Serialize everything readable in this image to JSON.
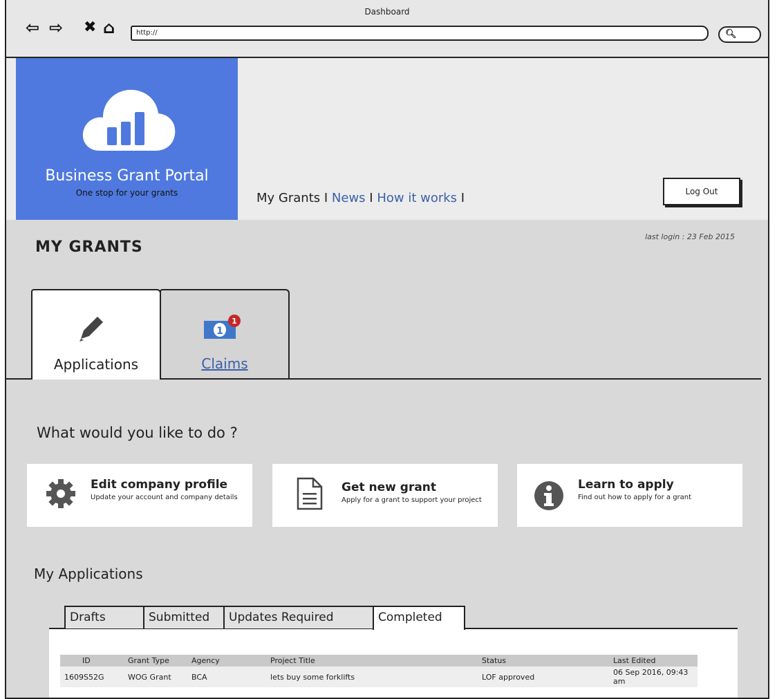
{
  "window": {
    "title": "Dashboard",
    "url": "http://"
  },
  "brand": {
    "name": "Business Grant Portal",
    "tagline": "One stop for your grants",
    "color": "#4f79de"
  },
  "topnav": {
    "items": [
      "My Grants",
      "News",
      "How it works"
    ],
    "separator": "I"
  },
  "header": {
    "logout_label": "Log Out"
  },
  "page": {
    "title": "MY GRANTS",
    "last_login": "last login : 23 Feb 2015"
  },
  "tabs": [
    {
      "label": "Applications",
      "icon": "pencil-icon",
      "active": true
    },
    {
      "label": "Claims",
      "icon": "money-icon",
      "badge": "1"
    }
  ],
  "actions": {
    "question": "What would you like to do ?",
    "cards": [
      {
        "title": "Edit company profile",
        "desc": "Update your account and company details",
        "icon": "gear-icon"
      },
      {
        "title": "Get new grant",
        "desc": "Apply for a grant to support your project",
        "icon": "document-icon"
      },
      {
        "title": "Learn to apply",
        "desc": "Find out how to apply for a grant",
        "icon": "info-icon"
      }
    ]
  },
  "applications": {
    "title": "My Applications",
    "subtabs": [
      "Drafts",
      "Submitted",
      "Updates Required",
      "Completed"
    ],
    "active_subtab": "Completed",
    "columns": [
      "ID",
      "Grant Type",
      "Agency",
      "Project Title",
      "Status",
      "Last Edited"
    ],
    "rows": [
      [
        "1609S52G",
        "WOG Grant",
        "BCA",
        "lets buy some forklifts",
        "LOF approved",
        "06 Sep 2016, 09:43 am"
      ]
    ]
  }
}
